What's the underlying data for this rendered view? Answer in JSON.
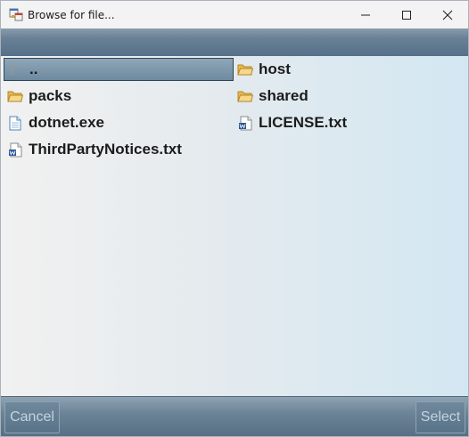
{
  "window": {
    "title": "Browse for file..."
  },
  "items": [
    {
      "label": "..",
      "icon": "up-folder-icon",
      "selected": true
    },
    {
      "label": "host",
      "icon": "folder-icon",
      "selected": false
    },
    {
      "label": "packs",
      "icon": "folder-icon",
      "selected": false
    },
    {
      "label": "shared",
      "icon": "folder-icon",
      "selected": false
    },
    {
      "label": "dotnet.exe",
      "icon": "file-icon",
      "selected": false
    },
    {
      "label": "LICENSE.txt",
      "icon": "word-document-icon",
      "selected": false
    },
    {
      "label": "ThirdPartyNotices.txt",
      "icon": "word-document-icon",
      "selected": false
    }
  ],
  "buttons": {
    "cancel": "Cancel",
    "select": "Select"
  },
  "colors": {
    "folder": "#e8b94a",
    "selection": "#7a93a7",
    "bar": "#5f788d"
  }
}
